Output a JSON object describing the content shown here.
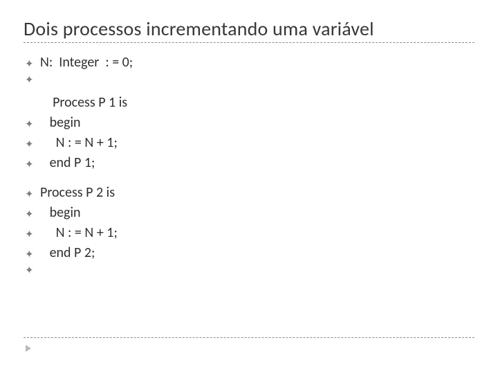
{
  "title": "Dois processos incrementando uma variável",
  "lines": [
    {
      "bullet": true,
      "text": "N:  Integer  : = 0;"
    },
    {
      "bullet": true,
      "text": ""
    },
    {
      "bullet": false,
      "text": "    Process P 1 is"
    },
    {
      "bullet": true,
      "text": "   begin"
    },
    {
      "bullet": true,
      "text": "     N : = N + 1;"
    },
    {
      "bullet": true,
      "text": "   end P 1;"
    },
    {
      "bullet": null,
      "text": ""
    },
    {
      "bullet": true,
      "text": "Process P 2 is"
    },
    {
      "bullet": true,
      "text": "   begin"
    },
    {
      "bullet": true,
      "text": "     N : = N + 1;"
    },
    {
      "bullet": true,
      "text": "   end P 2;"
    },
    {
      "bullet": true,
      "text": ""
    }
  ],
  "bullet_glyph": "✦"
}
